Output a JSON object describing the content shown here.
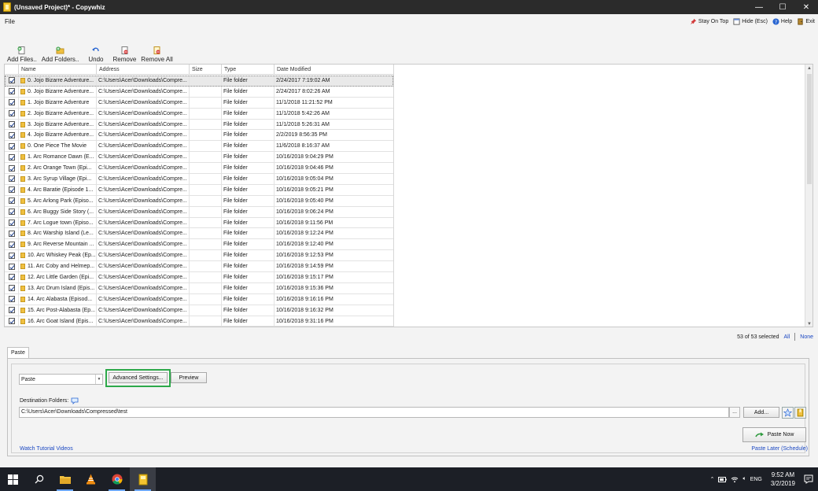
{
  "window": {
    "title": "(Unsaved Project)* - Copywhiz",
    "minimize": "—",
    "maximize": "☐",
    "close": "✕"
  },
  "menu": {
    "file": "File",
    "stay_on_top": "Stay On Top",
    "hide": "Hide (Esc)",
    "help": "Help",
    "exit": "Exit"
  },
  "toolbar": {
    "add_files": "Add Files..",
    "add_folders": "Add Folders..",
    "undo": "Undo",
    "remove": "Remove",
    "remove_all": "Remove All"
  },
  "table": {
    "columns": [
      "Name",
      "Address",
      "Size",
      "Type",
      "Date Modified"
    ],
    "rows": [
      {
        "name": "0. Jojo Bizarre Adventure...",
        "address": "C:\\Users\\Acer\\Downloads\\Compre...",
        "size": "",
        "type": "File folder",
        "date": "2/24/2017 7:19:02 AM"
      },
      {
        "name": "0. Jojo Bizarre Adventure...",
        "address": "C:\\Users\\Acer\\Downloads\\Compre...",
        "size": "",
        "type": "File folder",
        "date": "2/24/2017 8:02:26 AM"
      },
      {
        "name": "1. Jojo Bizarre Adventure",
        "address": "C:\\Users\\Acer\\Downloads\\Compre...",
        "size": "",
        "type": "File folder",
        "date": "11/1/2018 11:21:52 PM"
      },
      {
        "name": "2. Jojo Bizarre Adventure...",
        "address": "C:\\Users\\Acer\\Downloads\\Compre...",
        "size": "",
        "type": "File folder",
        "date": "11/1/2018 5:42:26 AM"
      },
      {
        "name": "3. Jojo Bizarre Adventure...",
        "address": "C:\\Users\\Acer\\Downloads\\Compre...",
        "size": "",
        "type": "File folder",
        "date": "11/1/2018 5:26:31 AM"
      },
      {
        "name": "4. Jojo Bizarre Adventure...",
        "address": "C:\\Users\\Acer\\Downloads\\Compre...",
        "size": "",
        "type": "File folder",
        "date": "2/2/2019 8:56:35 PM"
      },
      {
        "name": "0. One Piece The Movie",
        "address": "C:\\Users\\Acer\\Downloads\\Compre...",
        "size": "",
        "type": "File folder",
        "date": "11/6/2018 8:16:37 AM"
      },
      {
        "name": "1. Arc Romance Dawn (E...",
        "address": "C:\\Users\\Acer\\Downloads\\Compre...",
        "size": "",
        "type": "File folder",
        "date": "10/16/2018 9:04:29 PM"
      },
      {
        "name": "2. Arc Orange Town (Epi...",
        "address": "C:\\Users\\Acer\\Downloads\\Compre...",
        "size": "",
        "type": "File folder",
        "date": "10/16/2018 9:04:46 PM"
      },
      {
        "name": "3. Arc Syrup Village (Epi...",
        "address": "C:\\Users\\Acer\\Downloads\\Compre...",
        "size": "",
        "type": "File folder",
        "date": "10/16/2018 9:05:04 PM"
      },
      {
        "name": "4. Arc Baratie (Episode 1...",
        "address": "C:\\Users\\Acer\\Downloads\\Compre...",
        "size": "",
        "type": "File folder",
        "date": "10/16/2018 9:05:21 PM"
      },
      {
        "name": "5. Arc Arlong Park (Episo...",
        "address": "C:\\Users\\Acer\\Downloads\\Compre...",
        "size": "",
        "type": "File folder",
        "date": "10/16/2018 9:05:40 PM"
      },
      {
        "name": "6. Arc Buggy Side Story (...",
        "address": "C:\\Users\\Acer\\Downloads\\Compre...",
        "size": "",
        "type": "File folder",
        "date": "10/16/2018 9:06:24 PM"
      },
      {
        "name": "7. Arc Logue town (Episo...",
        "address": "C:\\Users\\Acer\\Downloads\\Compre...",
        "size": "",
        "type": "File folder",
        "date": "10/16/2018 9:11:56 PM"
      },
      {
        "name": "8. Arc Warship Island (Le...",
        "address": "C:\\Users\\Acer\\Downloads\\Compre...",
        "size": "",
        "type": "File folder",
        "date": "10/16/2018 9:12:24 PM"
      },
      {
        "name": "9. Arc Reverse Mountain ...",
        "address": "C:\\Users\\Acer\\Downloads\\Compre...",
        "size": "",
        "type": "File folder",
        "date": "10/16/2018 9:12:40 PM"
      },
      {
        "name": "10. Arc Whiskey Peak (Ep...",
        "address": "C:\\Users\\Acer\\Downloads\\Compre...",
        "size": "",
        "type": "File folder",
        "date": "10/16/2018 9:12:53 PM"
      },
      {
        "name": "11. Arc Coby and Helmep...",
        "address": "C:\\Users\\Acer\\Downloads\\Compre...",
        "size": "",
        "type": "File folder",
        "date": "10/16/2018 9:14:59 PM"
      },
      {
        "name": "12. Arc Little Garden (Epi...",
        "address": "C:\\Users\\Acer\\Downloads\\Compre...",
        "size": "",
        "type": "File folder",
        "date": "10/16/2018 9:15:17 PM"
      },
      {
        "name": "13. Arc Drum Island (Epis...",
        "address": "C:\\Users\\Acer\\Downloads\\Compre...",
        "size": "",
        "type": "File folder",
        "date": "10/16/2018 9:15:36 PM"
      },
      {
        "name": "14. Arc Alabasta (Episod...",
        "address": "C:\\Users\\Acer\\Downloads\\Compre...",
        "size": "",
        "type": "File folder",
        "date": "10/16/2018 9:16:16 PM"
      },
      {
        "name": "15. Arc Post-Alabasta (Ep...",
        "address": "C:\\Users\\Acer\\Downloads\\Compre...",
        "size": "",
        "type": "File folder",
        "date": "10/16/2018 9:16:32 PM"
      },
      {
        "name": "16. Arc Goat Island (Epis...",
        "address": "C:\\Users\\Acer\\Downloads\\Compre...",
        "size": "",
        "type": "File folder",
        "date": "10/16/2018 9:31:16 PM"
      }
    ]
  },
  "selection": {
    "count_text": "53 of 53 selected",
    "all": "All",
    "none": "None"
  },
  "paste_panel": {
    "tab": "Paste",
    "mode_value": "Paste",
    "advanced_settings": "Advanced Settings...",
    "preview": "Preview",
    "destination_label": "Destination Folders:",
    "destination_value": "C:\\Users\\Acer\\Downloads\\Compressed\\test",
    "browse": "...",
    "add": "Add...",
    "paste_now": "Paste Now",
    "paste_later": "Paste Later (Schedule)",
    "tutorial": "Watch Tutorial Videos"
  },
  "taskbar": {
    "language": "ENG",
    "time": "9:52 AM",
    "date": "3/2/2019"
  },
  "colors": {
    "highlight_green": "#2da94a",
    "link_blue": "#1a47c2",
    "taskbar": "#1c1f26"
  }
}
